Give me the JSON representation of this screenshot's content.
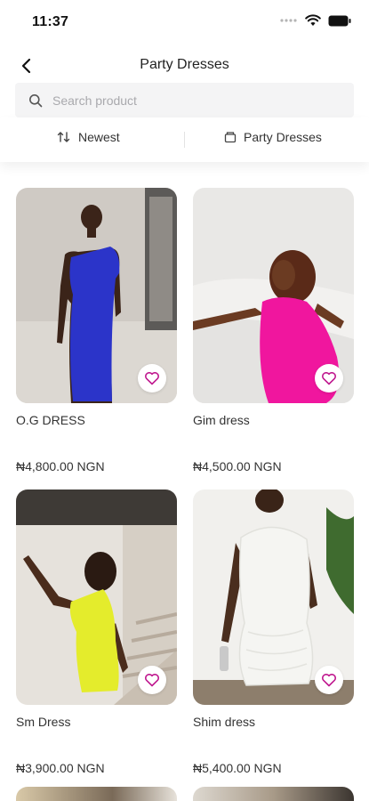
{
  "status_bar": {
    "time": "11:37"
  },
  "header": {
    "title": "Party Dresses"
  },
  "search": {
    "placeholder": "Search product",
    "value": ""
  },
  "filters": {
    "sort_label": "Newest",
    "category_label": "Party Dresses"
  },
  "products": [
    {
      "name": "O.G DRESS",
      "price": "₦4,800.00 NGN",
      "dress_color": "#2b34c9",
      "favorite": false
    },
    {
      "name": "Gim dress",
      "price": "₦4,500.00 NGN",
      "dress_color": "#f0169e",
      "favorite": false
    },
    {
      "name": "Sm Dress",
      "price": "₦3,900.00 NGN",
      "dress_color": "#e4ec2c",
      "favorite": false
    },
    {
      "name": "Shim dress",
      "price": "₦5,400.00 NGN",
      "dress_color": "#f5f5f2",
      "favorite": false
    }
  ],
  "colors": {
    "accent": "#c0198f",
    "search_bg": "#f4f4f5",
    "text": "#333333"
  }
}
